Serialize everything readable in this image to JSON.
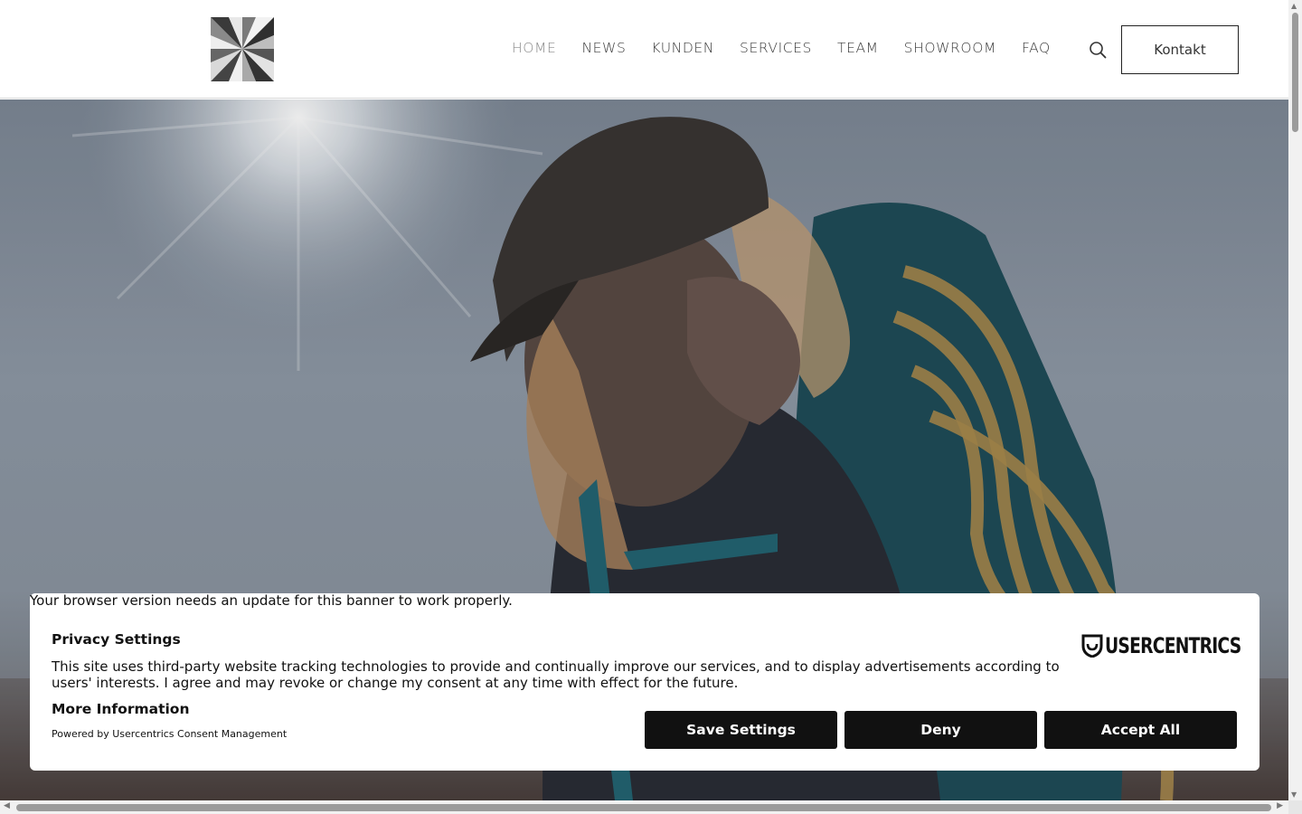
{
  "header": {
    "nav": [
      {
        "label": "HOME",
        "active": true
      },
      {
        "label": "NEWS"
      },
      {
        "label": "KUNDEN"
      },
      {
        "label": "SERVICES"
      },
      {
        "label": "TEAM"
      },
      {
        "label": "SHOWROOM"
      },
      {
        "label": "FAQ"
      }
    ],
    "search_icon": "search-icon",
    "contact_label": "Kontakt"
  },
  "hero": {
    "image": "woman-with-climbing-rope-backpack-in-sunlight"
  },
  "consent": {
    "browser_warning": "Your browser version needs an update for this banner to work properly.",
    "title": "Privacy Settings",
    "text": "This site uses third-party website tracking technologies to provide and continually improve our services, and to display advertisements according to users' interests. I agree and may revoke or change my consent at any time with effect for the future.",
    "more_info": "More Information",
    "powered_by": "Powered by Usercentrics Consent Management",
    "brand": "USERCENTRICS",
    "buttons": {
      "save": "Save Settings",
      "deny": "Deny",
      "accept": "Accept All"
    },
    "button_color": "#111111"
  }
}
